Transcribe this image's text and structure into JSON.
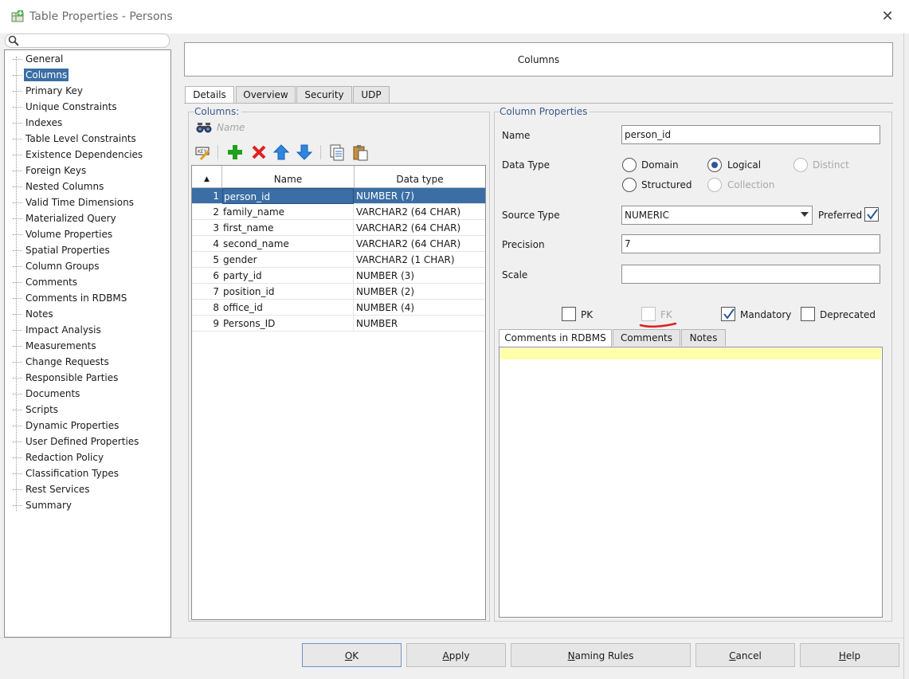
{
  "window": {
    "title": "Table Properties - Persons",
    "close_glyph": "✕"
  },
  "nav": {
    "items": [
      "General",
      "Columns",
      "Primary Key",
      "Unique Constraints",
      "Indexes",
      "Table Level Constraints",
      "Existence Dependencies",
      "Foreign Keys",
      "Nested Columns",
      "Valid Time Dimensions",
      "Materialized Query",
      "Volume Properties",
      "Spatial Properties",
      "Column Groups",
      "Comments",
      "Comments in RDBMS",
      "Notes",
      "Impact Analysis",
      "Measurements",
      "Change Requests",
      "Responsible Parties",
      "Documents",
      "Scripts",
      "Dynamic Properties",
      "User Defined Properties",
      "Redaction Policy",
      "Classification Types",
      "Rest Services",
      "Summary"
    ],
    "selected": "Columns"
  },
  "header": {
    "title": "Columns"
  },
  "tabs": [
    "Details",
    "Overview",
    "Security",
    "UDP"
  ],
  "columns_panel": {
    "label": "Columns:",
    "filter_placeholder": "Name",
    "headers": {
      "sort": "▲",
      "name": "Name",
      "type": "Data type"
    },
    "rows": [
      {
        "num": "1",
        "name": "person_id",
        "type": "NUMBER (7)"
      },
      {
        "num": "2",
        "name": "family_name",
        "type": "VARCHAR2 (64 CHAR)"
      },
      {
        "num": "3",
        "name": "first_name",
        "type": "VARCHAR2 (64 CHAR)"
      },
      {
        "num": "4",
        "name": "second_name",
        "type": "VARCHAR2 (64 CHAR)"
      },
      {
        "num": "5",
        "name": "gender",
        "type": "VARCHAR2 (1 CHAR)"
      },
      {
        "num": "6",
        "name": "party_id",
        "type": "NUMBER (3)"
      },
      {
        "num": "7",
        "name": "position_id",
        "type": "NUMBER (2)"
      },
      {
        "num": "8",
        "name": "office_id",
        "type": "NUMBER (4)"
      },
      {
        "num": "9",
        "name": "Persons_ID",
        "type": "NUMBER"
      }
    ]
  },
  "props": {
    "label": "Column Properties",
    "name_label": "Name",
    "name_value": "person_id",
    "datatype_label": "Data Type",
    "radio_domain": "Domain",
    "radio_logical": "Logical",
    "radio_distinct": "Distinct",
    "radio_structured": "Structured",
    "radio_collection": "Collection",
    "source_type_label": "Source Type",
    "source_type_value": "NUMERIC",
    "preferred_label": "Preferred",
    "precision_label": "Precision",
    "precision_value": "7",
    "scale_label": "Scale",
    "scale_value": "",
    "pk_label": "PK",
    "fk_label": "FK",
    "mandatory_label": "Mandatory",
    "deprecated_label": "Deprecated",
    "lower_tabs": [
      "Comments in RDBMS",
      "Comments",
      "Notes"
    ]
  },
  "buttons": {
    "ok": "OK",
    "apply": "Apply",
    "naming_rules": "Naming Rules",
    "cancel": "Cancel",
    "help": "Help"
  },
  "colors": {
    "selection": "#3a6ea5",
    "accent_label": "#3a5a8c",
    "annotation_red": "#e02020"
  }
}
